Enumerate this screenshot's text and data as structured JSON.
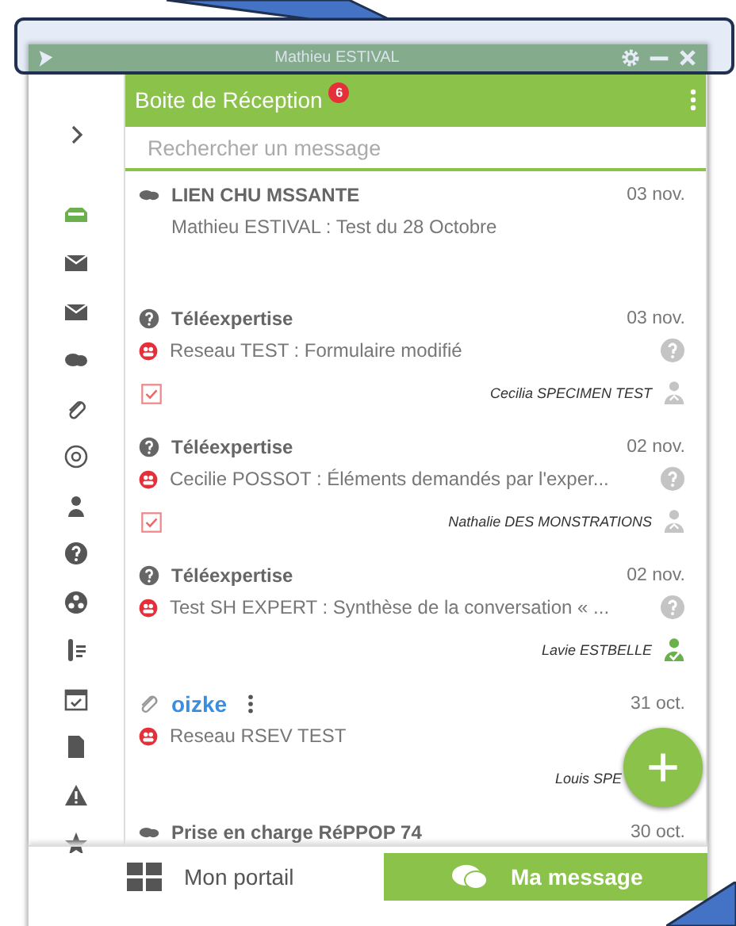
{
  "window": {
    "title": "Mathieu ESTIVAL"
  },
  "sidebar": {
    "items": [
      {
        "selected": false
      },
      {
        "selected": true
      },
      {
        "selected": false
      },
      {
        "selected": false
      },
      {
        "selected": false
      },
      {
        "selected": false
      },
      {
        "selected": false
      },
      {
        "selected": false
      },
      {
        "selected": false
      },
      {
        "selected": false
      },
      {
        "selected": false
      },
      {
        "selected": false
      },
      {
        "selected": false
      },
      {
        "selected": false
      },
      {
        "selected": false
      }
    ]
  },
  "inbox": {
    "title": "Boite de Réception",
    "badge": "6",
    "search": {
      "placeholder": "Rechercher un message"
    }
  },
  "messages": [
    {
      "kind": "chat",
      "title": "LIEN CHU MSSANTE",
      "date": "03 nov.",
      "subtitle": "Mathieu ESTIVAL : Test du 28 Octobre"
    },
    {
      "kind": "teleexpertise",
      "title": "Téléexpertise",
      "date": "03 nov.",
      "subtitle": "Reseau TEST : Formulaire modifié",
      "task": {
        "checked": true
      },
      "signer": {
        "name": "Cecilia SPECIMEN TEST",
        "validated": false
      }
    },
    {
      "kind": "teleexpertise",
      "title": "Téléexpertise",
      "date": "02 nov.",
      "subtitle": "Cecilie POSSOT : Éléments demandés par l'exper...",
      "task": {
        "checked": true
      },
      "signer": {
        "name": "Nathalie DES MONSTRATIONS",
        "validated": false
      }
    },
    {
      "kind": "teleexpertise",
      "title": "Téléexpertise",
      "date": "02 nov.",
      "subtitle": "Test SH EXPERT : Synthèse de la conversation « ...",
      "signer": {
        "name": "Lavie ESTBELLE",
        "validated": true
      }
    },
    {
      "kind": "attachment",
      "title": "oizke",
      "date": "31 oct.",
      "subtitle": "Reseau RSEV TEST",
      "signer": {
        "name": "Louis SPE"
      }
    },
    {
      "kind": "chat",
      "title": "Prise en charge RéPPOP 74",
      "date": "30 oct."
    }
  ],
  "bottom_nav": [
    {
      "label": "Mon portail",
      "selected": false
    },
    {
      "label": "Ma message",
      "selected": true
    }
  ]
}
